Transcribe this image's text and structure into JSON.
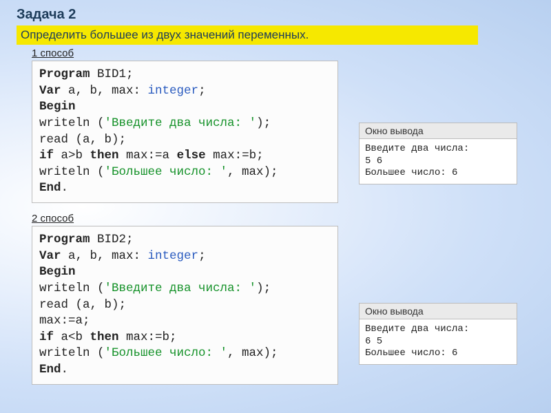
{
  "title": "Задача 2",
  "task": "Определить большее из двух значений переменных.",
  "method1_label": "1 способ",
  "method2_label": "2 способ",
  "code1": {
    "kw_program": "Program",
    "prog_name": " BID1;",
    "kw_var": "Var",
    "var_decl": " a, b, max: ",
    "typ_int": "integer",
    "semi": ";",
    "kw_begin": "Begin",
    "writeln1a": "writeln (",
    "str_prompt": "'Введите два числа: '",
    "writeln1b": ");",
    "read_line": "read (a, b);",
    "kw_if": "if",
    "if_cond": " a>b ",
    "kw_then": "then",
    "then_body": " max:=a ",
    "kw_else": "else",
    "else_body": " max:=b;",
    "writeln2a": "writeln (",
    "str_result": "'Большее число: '",
    "writeln2b": ", max);",
    "kw_end": "End",
    "end_dot": "."
  },
  "code2": {
    "kw_program": "Program",
    "prog_name": " BID2;",
    "kw_var": "Var",
    "var_decl": " a, b, max: ",
    "typ_int": "integer",
    "semi": ";",
    "kw_begin": "Begin",
    "writeln1a": "writeln (",
    "str_prompt": "'Введите два числа: '",
    "writeln1b": ");",
    "read_line": "read (a, b);",
    "assign_line": "max:=a;",
    "kw_if": "if",
    "if_cond": " a<b ",
    "kw_then": "then",
    "then_body": " max:=b;",
    "writeln2a": "writeln (",
    "str_result": "'Большее число: '",
    "writeln2b": ", max);",
    "kw_end": "End",
    "end_dot": "."
  },
  "output1": {
    "header": "Окно вывода",
    "body": "Введите два числа:\n5 6\nБольшее число: 6"
  },
  "output2": {
    "header": "Окно вывода",
    "body": "Введите два числа:\n6 5\nБольшее число: 6"
  }
}
